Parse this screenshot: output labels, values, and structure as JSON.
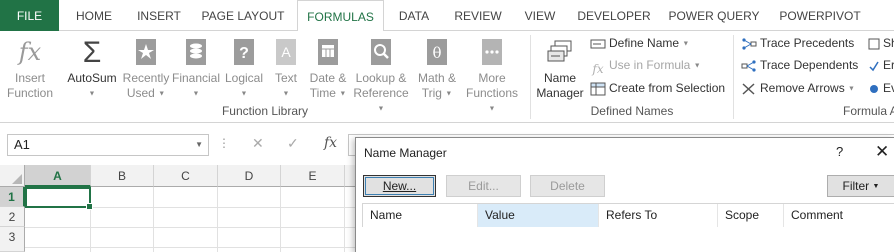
{
  "tabs": [
    {
      "label": "FILE",
      "active": false,
      "file": true
    },
    {
      "label": "HOME",
      "active": false
    },
    {
      "label": "INSERT",
      "active": false
    },
    {
      "label": "PAGE LAYOUT",
      "active": false
    },
    {
      "label": "FORMULAS",
      "active": true
    },
    {
      "label": "DATA",
      "active": false
    },
    {
      "label": "REVIEW",
      "active": false
    },
    {
      "label": "VIEW",
      "active": false
    },
    {
      "label": "DEVELOPER",
      "active": false
    },
    {
      "label": "POWER QUERY",
      "active": false
    },
    {
      "label": "POWERPIVOT",
      "active": false
    }
  ],
  "ribbon": {
    "function_library": {
      "label": "Function Library",
      "insert_function": {
        "line1": "Insert",
        "line2": "Function",
        "icon": "fx-icon"
      },
      "autosum": {
        "line1": "AutoSum",
        "icon": "sigma-icon"
      },
      "recently_used": {
        "line1": "Recently",
        "line2": "Used",
        "icon": "star-book-icon"
      },
      "financial": {
        "line1": "Financial",
        "icon": "coins-book-icon"
      },
      "logical": {
        "line1": "Logical",
        "icon": "question-book-icon"
      },
      "text": {
        "line1": "Text",
        "icon": "text-book-icon"
      },
      "date_time": {
        "line1": "Date &",
        "line2": "Time",
        "icon": "calendar-book-icon"
      },
      "lookup_reference": {
        "line1": "Lookup &",
        "line2": "Reference",
        "icon": "magnifier-book-icon"
      },
      "math_trig": {
        "line1": "Math &",
        "line2": "Trig",
        "icon": "theta-book-icon"
      },
      "more_functions": {
        "line1": "More",
        "line2": "Functions",
        "icon": "more-book-icon"
      }
    },
    "defined_names": {
      "label": "Defined Names",
      "name_manager": {
        "line1": "Name",
        "line2": "Manager",
        "icon": "name-tags-icon"
      },
      "define_name": "Define Name",
      "use_in_formula": "Use in Formula",
      "create_from_selection": "Create from Selection"
    },
    "formula_auditing": {
      "label": "Formula A",
      "trace_precedents": "Trace Precedents",
      "trace_dependents": "Trace Dependents",
      "remove_arrows": "Remove Arrows",
      "cut_1": "Sh",
      "cut_2": "Er",
      "cut_3": "Ev"
    }
  },
  "formula_bar": {
    "name_box": "A1",
    "fx": "fx",
    "cancel": "✕",
    "enter": "✓",
    "value": ""
  },
  "grid": {
    "columns": [
      "A",
      "B",
      "C",
      "D",
      "E"
    ],
    "rows": [
      "1",
      "2",
      "3"
    ],
    "active_cell": "A1"
  },
  "dialog": {
    "title": "Name Manager",
    "help": "?",
    "close": "✕",
    "buttons": {
      "new": "New...",
      "edit": "Edit...",
      "delete": "Delete",
      "filter": "Filter"
    },
    "columns": [
      "Name",
      "Value",
      "Refers To",
      "Scope",
      "Comment"
    ]
  }
}
